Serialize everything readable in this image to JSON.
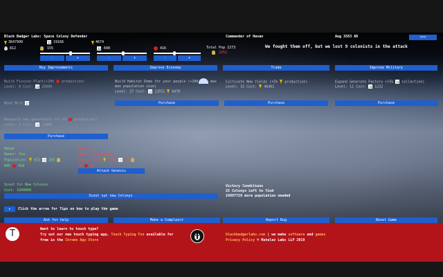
{
  "header": {
    "title": "Black Badger Labs: Space Colony Defender",
    "commander": "Commander of Havan",
    "date": "Aug 3583 AD",
    "top_right_button": ">>>"
  },
  "resources": {
    "energy": "3647990",
    "grid": "19166",
    "water": "4674",
    "food": "812",
    "food_slider": "155",
    "grid_slider": "690",
    "food2": "416",
    "total_pop_label": "Total Pop 2273",
    "total_pop_sub": "2252",
    "stepper_labels": [
      "-",
      "+",
      "-",
      "+",
      "-",
      "+"
    ]
  },
  "message": "We fought them off, but we lost 9 colonists in the attack",
  "tabs": [
    "Key Improvements",
    "Improve Economy",
    "Trade",
    "Improve Military"
  ],
  "improvements": [
    {
      "name": "Build Fission Plant(+10%",
      "name_tail": "production)",
      "level": "Level: 0 Cost:",
      "cost": "25000"
    },
    {
      "name": "Build Habitat Dome for your people (+100",
      "name_tail": "max population size)",
      "level": "Level: 27 Cost:",
      "cost": "13552",
      "cost2": "6470"
    },
    {
      "name": "Cultivate New fields (+5%",
      "name_tail": "production)",
      "level": "Level: 33 Cost:",
      "cost": "46401"
    },
    {
      "name": "Expand Generate Factory (+5%",
      "name_tail": "collection)",
      "level": "Level: 11 Cost:",
      "cost": "1232"
    }
  ],
  "purchase_label": "Purchase",
  "need_more": "Need More",
  "research": {
    "name": "Research new generators (+7.5%",
    "name_tail": "production)",
    "level": "Level: 1 Cost:",
    "cost": "12806"
  },
  "colonies": {
    "home": {
      "name": "Havan",
      "owner": "Owner: You",
      "population_label": "Population:",
      "pop1": "813",
      "pop2": "255",
      "row2_a": "895",
      "row2_b": "410"
    },
    "enemy": {
      "name": "Genesis",
      "owner": "Owner: Rowdumbles",
      "population_label": "Population:",
      "pop1": "1706",
      "pop2": "90",
      "row2_a": "18",
      "row2_b": "10"
    },
    "attack_label": "Attack Genesis"
  },
  "scout": {
    "title": "Scout for New Colonys",
    "cost": "Cost: 3200000",
    "button": "Scout out new Colonys"
  },
  "victory": {
    "title": "Victory Conditions",
    "line1": "25 Colonys Left to find",
    "line2": "24997726 more population needed"
  },
  "tips": {
    "arrow": "▸",
    "text": "Click the arrow for Tips on how to play the game"
  },
  "bottom_buttons": [
    "Ask for help",
    "Make a Complaint",
    "Report Bug",
    "Reset Game"
  ],
  "footer": {
    "line1": "Want to learn to touch type?",
    "line2_pre": "Try out our new touch typing app,",
    "line2_link": "Touch Typing Fun",
    "line2_post": "available for",
    "line3_pre": "free in the",
    "line3_link": "Chrome App Store",
    "right1_link": "blackbadgerlabs.com",
    "right1_mid": "| we make",
    "right1_link2": "software",
    "right1_and": "and",
    "right1_link3": "games",
    "right2_link": "Privacy Policy",
    "right2_post": "© Matelez Labs LLP 2019",
    "logo_letter": "T"
  },
  "colors": {
    "button_blue": "#1f5fcf",
    "footer_red": "#b3141a",
    "enemy_red": "#ff4a4a",
    "friendly_green": "#7fe07f"
  }
}
